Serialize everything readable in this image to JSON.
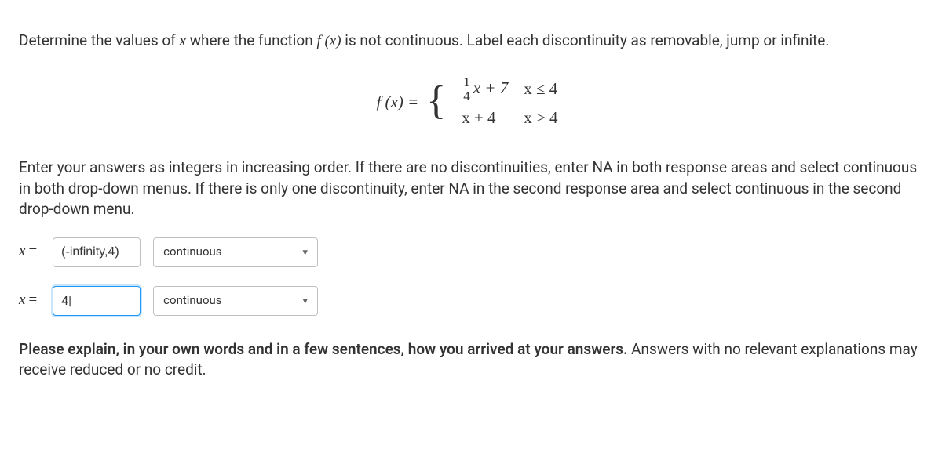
{
  "question": {
    "prompt_pre": "Determine the values of ",
    "var_x": "x",
    "prompt_mid": " where the function ",
    "func": "f (x)",
    "prompt_post": " is not continuous. Label each discontinuity as removable, jump or infinite."
  },
  "equation": {
    "lhs": "f (x) =",
    "pieces": [
      {
        "expr_frac_num": "1",
        "expr_frac_den": "4",
        "expr_tail": "x + 7",
        "cond": "x ≤ 4"
      },
      {
        "expr": "x + 4",
        "cond": "x > 4"
      }
    ]
  },
  "instructions": "Enter your answers as integers in increasing order. If there are no discontinuities, enter NA in both response areas and select continuous in both drop-down menus. If there is only one discontinuity, enter NA in the second response area and select continuous in the second drop-down menu.",
  "answers": [
    {
      "label_var": "x",
      "label_eq": "=",
      "value": "(-infinity,4)",
      "select": "continuous",
      "focused": false
    },
    {
      "label_var": "x",
      "label_eq": "=",
      "value": "4",
      "select": "continuous",
      "focused": true
    }
  ],
  "explain": {
    "bold": "Please explain, in your own words and in a few sentences, how you arrived at your answers.",
    "rest": " Answers with no relevant explanations may receive reduced or no credit."
  }
}
